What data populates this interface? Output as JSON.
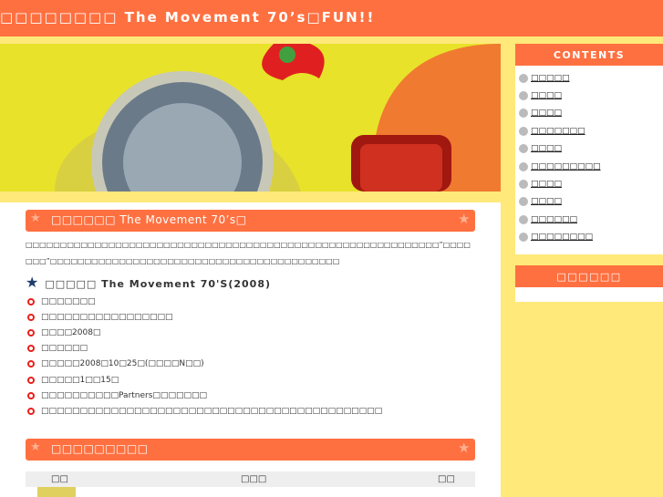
{
  "header": {
    "title": "□□□□□□□□ The Movement 70’s□FUN!!"
  },
  "main": {
    "section1": {
      "title": "□□□□□□ The Movement 70’s□",
      "intro": "□□□□□□□□□□□□□□□□□□□□□□□□□□□□□□□□□□□□□□□□□□□□□□□□□□□□□□□□□□□□”□□□□□□□”□□□□□□□□□□□□□□□□□□□□□□□□□□□□□□□□□□□□□□□□□□",
      "subtitle": "□□□□□ The Movement 70'S(2008)",
      "items": [
        "□□□□□□□",
        "□□□□□□□□□□□□□□□□□",
        "□□□□2008□",
        "□□□□□□",
        "□□□□□2008□10□25□(□□□□N□□)",
        "□□□□□1□□15□",
        "□□□□□□□□□□Partners□□□□□□□",
        "□□□□□□□□□□□□□□□□□□□□□□□□□□□□□□□□□□□□□□□□□□□□"
      ]
    },
    "section2": {
      "title": "□□□□□□□□□",
      "columns": [
        "□□",
        "□□□",
        "□□"
      ]
    }
  },
  "sidebar": {
    "contents_title": "CONTENTS",
    "items": [
      "□□□□□",
      "□□□□",
      "□□□□",
      "□□□□□□□",
      "□□□□",
      "□□□□□□□□□",
      "□□□□",
      "□□□□",
      "□□□□□□",
      "□□□□□□□□"
    ],
    "box2_title": "□□□□□□"
  },
  "colors": {
    "accent": "#ff7040",
    "background": "#ffe97a",
    "bullet": "#e8201a",
    "star": "#1e3c6e"
  }
}
